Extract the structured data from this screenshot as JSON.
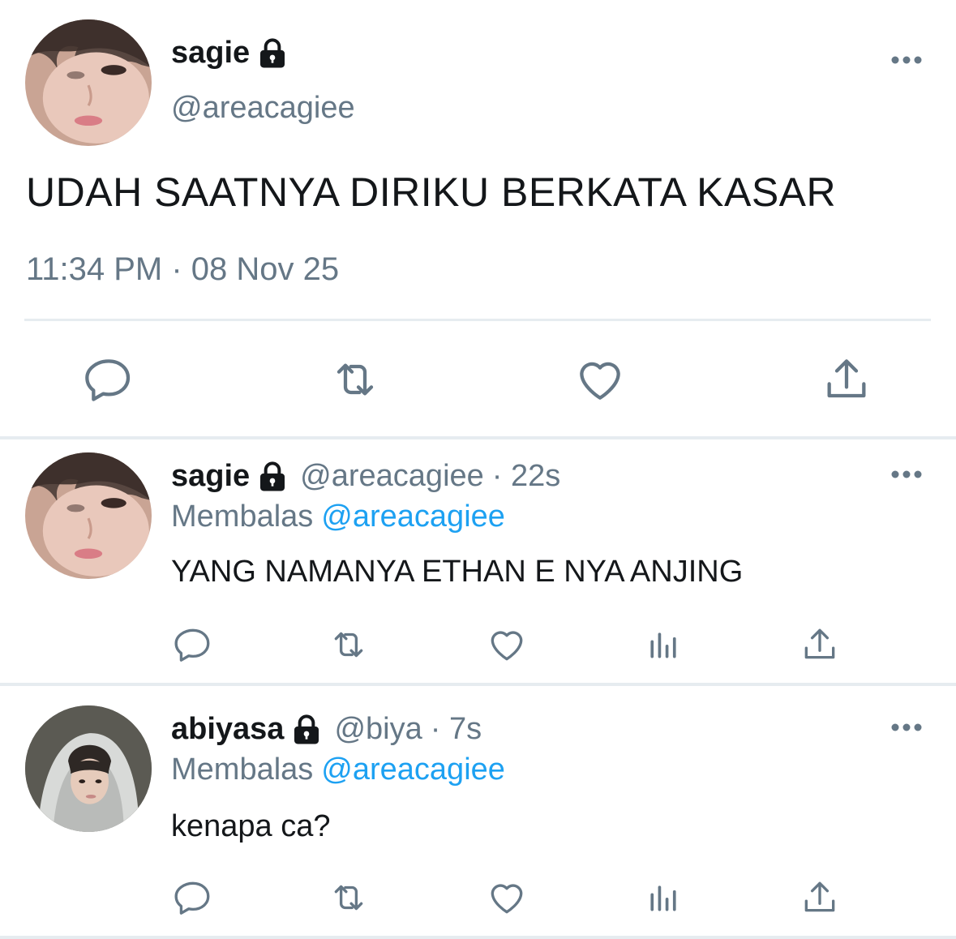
{
  "main_tweet": {
    "name": "sagie",
    "handle": "@areacagiee",
    "text": "UDAH SAATNYA DIRIKU BERKATA KASAR",
    "timestamp": "11:34 PM · 08 Nov 25",
    "actions": [
      "reply-icon",
      "retweet-icon",
      "like-icon",
      "share-icon"
    ]
  },
  "replies": [
    {
      "name": "sagie",
      "handle": "@areacagiee",
      "time": "· 22s",
      "replying_label": "Membalas",
      "replying_to": "@areacagiee",
      "text": "YANG NAMANYA ETHAN E NYA ANJING",
      "actions": [
        "reply-icon",
        "retweet-icon",
        "like-icon",
        "analytics-icon",
        "share-icon"
      ]
    },
    {
      "name": "abiyasa",
      "handle": "@biya",
      "time": "· 7s",
      "replying_label": "Membalas",
      "replying_to": "@areacagiee",
      "text": "kenapa ca?",
      "actions": [
        "reply-icon",
        "retweet-icon",
        "like-icon",
        "analytics-icon",
        "share-icon"
      ]
    }
  ],
  "colors": {
    "text": "#14171a",
    "secondary": "#657786",
    "link": "#1da1f2",
    "divider": "#e6ecf0"
  }
}
